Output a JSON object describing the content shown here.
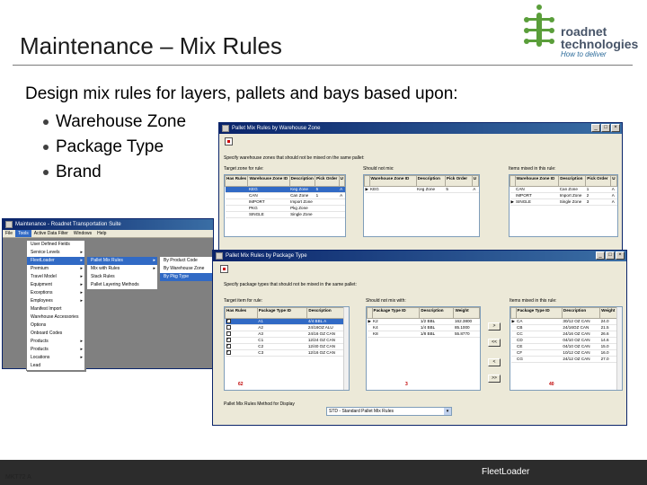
{
  "slide": {
    "title": "Maintenance – Mix Rules",
    "intro": "Design mix rules for layers, pallets and bays based upon:",
    "bullets": [
      "Warehouse Zone",
      "Package Type",
      "Brand"
    ],
    "footer_left": "MKT72 A",
    "footer_center": "FleetLoader"
  },
  "logo": {
    "line1": "roadnet",
    "line2": "technologies",
    "tagline": "How to deliver",
    "colors": {
      "green": "#5a9e3a",
      "text": "#475468"
    }
  },
  "zone_window": {
    "title": "Pallet Mix Rules by Warehouse Zone",
    "prompt": "Specify warehouse zones that should not be mixed on the same pallet:",
    "target_label": "Target zone for rule:",
    "should_label": "Should not mix:",
    "items_label": "Items mixed in this rule:",
    "target_columns": [
      "Has Rules",
      "Warehouse Zone ID",
      "Description",
      "Pick Order",
      "U"
    ],
    "target_rows": [
      [
        "",
        "KEG",
        "Keg Zone",
        "5",
        "A"
      ],
      [
        "",
        "CAN",
        "Can Zone",
        "1",
        "A"
      ],
      [
        "",
        "IMPORT",
        "Import Zone",
        "",
        ""
      ],
      [
        "",
        "PKG",
        "Pkg Zone",
        "",
        ""
      ],
      [
        "",
        "SINGLE",
        "Single Zone",
        "",
        ""
      ]
    ],
    "should_columns": [
      "Warehouse Zone ID",
      "Description",
      "Pick Order",
      "U"
    ],
    "should_rows": [
      [
        "KEG",
        "Keg Zone",
        "5",
        "A"
      ]
    ],
    "items_columns": [
      "Warehouse Zone ID",
      "Description",
      "Pick Order",
      "U"
    ],
    "items_rows": [
      [
        "CAN",
        "Can Zone",
        "1",
        "A"
      ],
      [
        "IMPORT",
        "Import Zone",
        "2",
        "A"
      ],
      [
        "SINGLE",
        "Single Zone",
        "3",
        "A"
      ]
    ]
  },
  "main_window": {
    "title": "Maintenance - Roadnet Transportation Suite",
    "menus": [
      "File",
      "Tools",
      "Active Data Filter",
      "Windows",
      "Help"
    ],
    "tools_items": [
      "User Defined Fields",
      "Service Levels",
      "FleetLoader",
      "Premium",
      "Travel Model",
      "Equipment",
      "Exceptions",
      "Employees",
      "Manifest Import",
      "Warehouse Accessories",
      "Options",
      "Onboard Codes",
      "Products",
      "Products",
      "Locations",
      "Lead"
    ],
    "fleetloader_items": [
      "Pallet Mix Rules",
      "Mix with Rules",
      "Stack Rules",
      "Pallet Layering Methods"
    ],
    "mix_items": [
      "By Product Code",
      "By Warehouse Zone",
      "By Pkg Type"
    ]
  },
  "pkg_window": {
    "title": "Pallet Mix Rules by Package Type",
    "prompt": "Specify package types that should not be mixed in the same pallet:",
    "target_label": "Target item for rule:",
    "should_label": "Should not mix with:",
    "items_label": "Items mixed in this rule:",
    "target_columns": [
      "Has Rules",
      "Package Type ID",
      "Description"
    ],
    "target_rows": [
      {
        "on": true,
        "id": "A1",
        "desc": "4/4 BBL A"
      },
      {
        "on": false,
        "id": "A2",
        "desc": "24/16OZ ALU"
      },
      {
        "on": false,
        "id": "A3",
        "desc": "24/16 OZ CAN"
      },
      {
        "on": true,
        "id": "C1",
        "desc": "12/24 OZ CAN"
      },
      {
        "on": true,
        "id": "C2",
        "desc": "12/40 OZ CAN"
      },
      {
        "on": true,
        "id": "C3",
        "desc": "12/16 OZ CAN"
      }
    ],
    "target_total": "62",
    "should_columns": [
      "Package Type ID",
      "Description",
      "Weight"
    ],
    "should_rows": [
      [
        "K2",
        "1/2 BBL",
        "162.3800"
      ],
      [
        "K4",
        "1/4 BBL",
        "85.1000"
      ],
      [
        "K8",
        "1/8 BBL",
        "55.8770"
      ]
    ],
    "should_total": "3",
    "items_columns": [
      "Package Type ID",
      "Description",
      "Weight"
    ],
    "items_rows": [
      [
        "CA",
        "30/12 OZ CAN",
        "24.0"
      ],
      [
        "CB",
        "24/16OZ CAN",
        "21.5"
      ],
      [
        "CC",
        "24/16 OZ CAN",
        "26.6"
      ],
      [
        "CD",
        "04/10 OZ CAN",
        "14.6"
      ],
      [
        "CE",
        "04/10 OZ CAN",
        "15.0"
      ],
      [
        "CF",
        "10/12 OZ CAN",
        "16.0"
      ],
      [
        "CG",
        "24/12 OZ CAN",
        "27.0"
      ]
    ],
    "items_total": "40",
    "buttons": [
      ">",
      "<<",
      "<",
      ">>"
    ],
    "method_label": "Pallet Mix Rules Method for Display",
    "method_value": "STD - Standard Pallet Mix Rules"
  }
}
